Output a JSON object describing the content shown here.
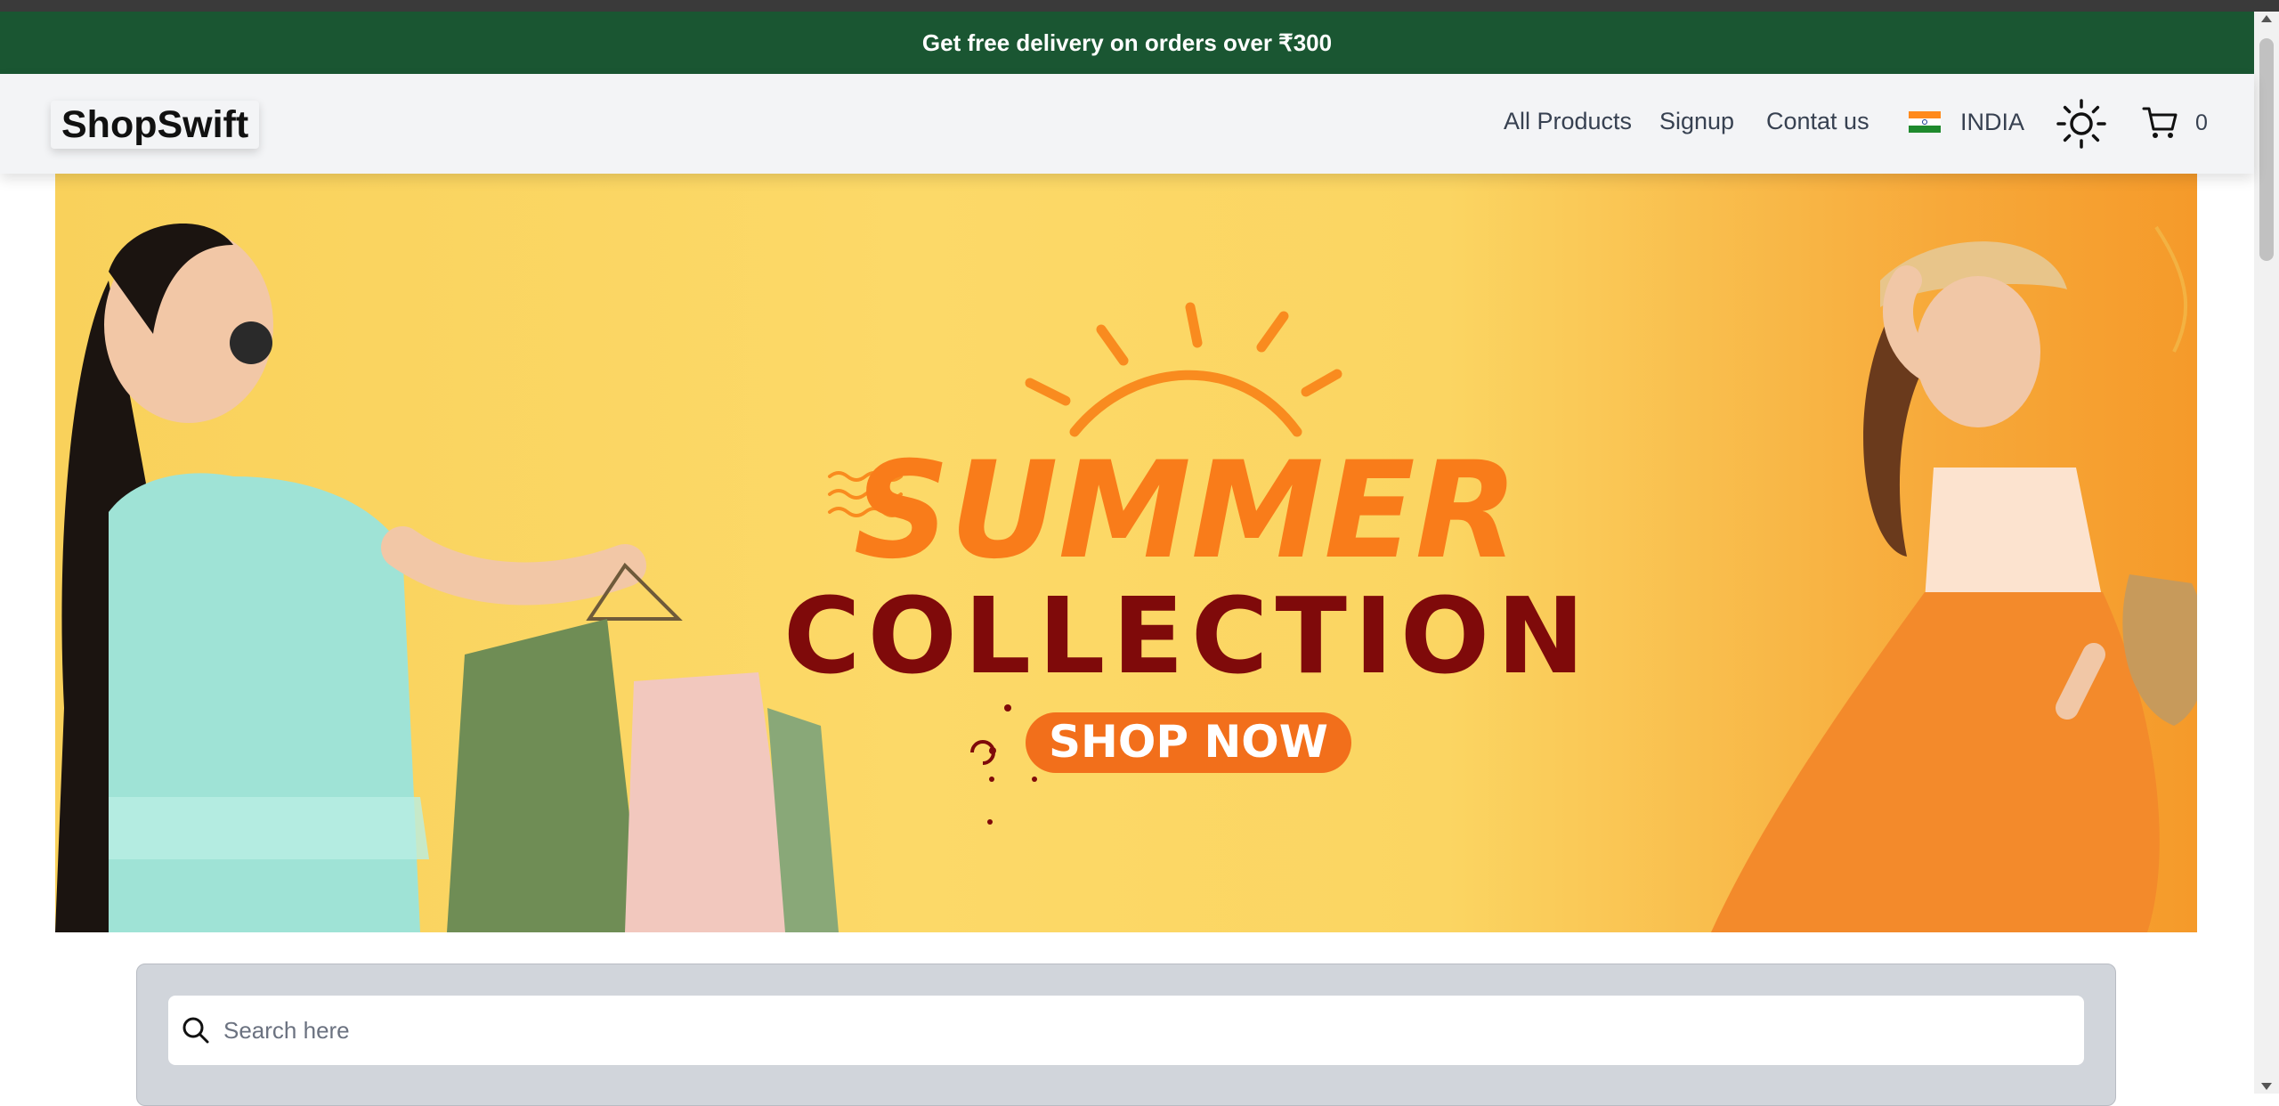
{
  "promo": {
    "text": "Get free delivery on orders over ₹300"
  },
  "brand": {
    "logo": "ShopSwift"
  },
  "nav": {
    "links": [
      "All Products",
      "Signup",
      "Contat us"
    ],
    "country": "INDIA",
    "flag_icon": "india-flag-icon",
    "theme_icon": "sun-icon",
    "cart_icon": "cart-icon",
    "cart_count": "0"
  },
  "banner": {
    "headline": "SUMMER",
    "subheadline": "COLLECTION",
    "cta": "SHOP NOW"
  },
  "search": {
    "placeholder": "Search here",
    "icon": "search-icon"
  },
  "colors": {
    "promo_bg": "#1a5632",
    "navbar_bg": "#f3f4f6",
    "banner_yellow": "#fcd968",
    "headline_orange": "#f97c1a",
    "subheadline_maroon": "#7f0a0a",
    "cta_orange": "#f26f1b"
  }
}
